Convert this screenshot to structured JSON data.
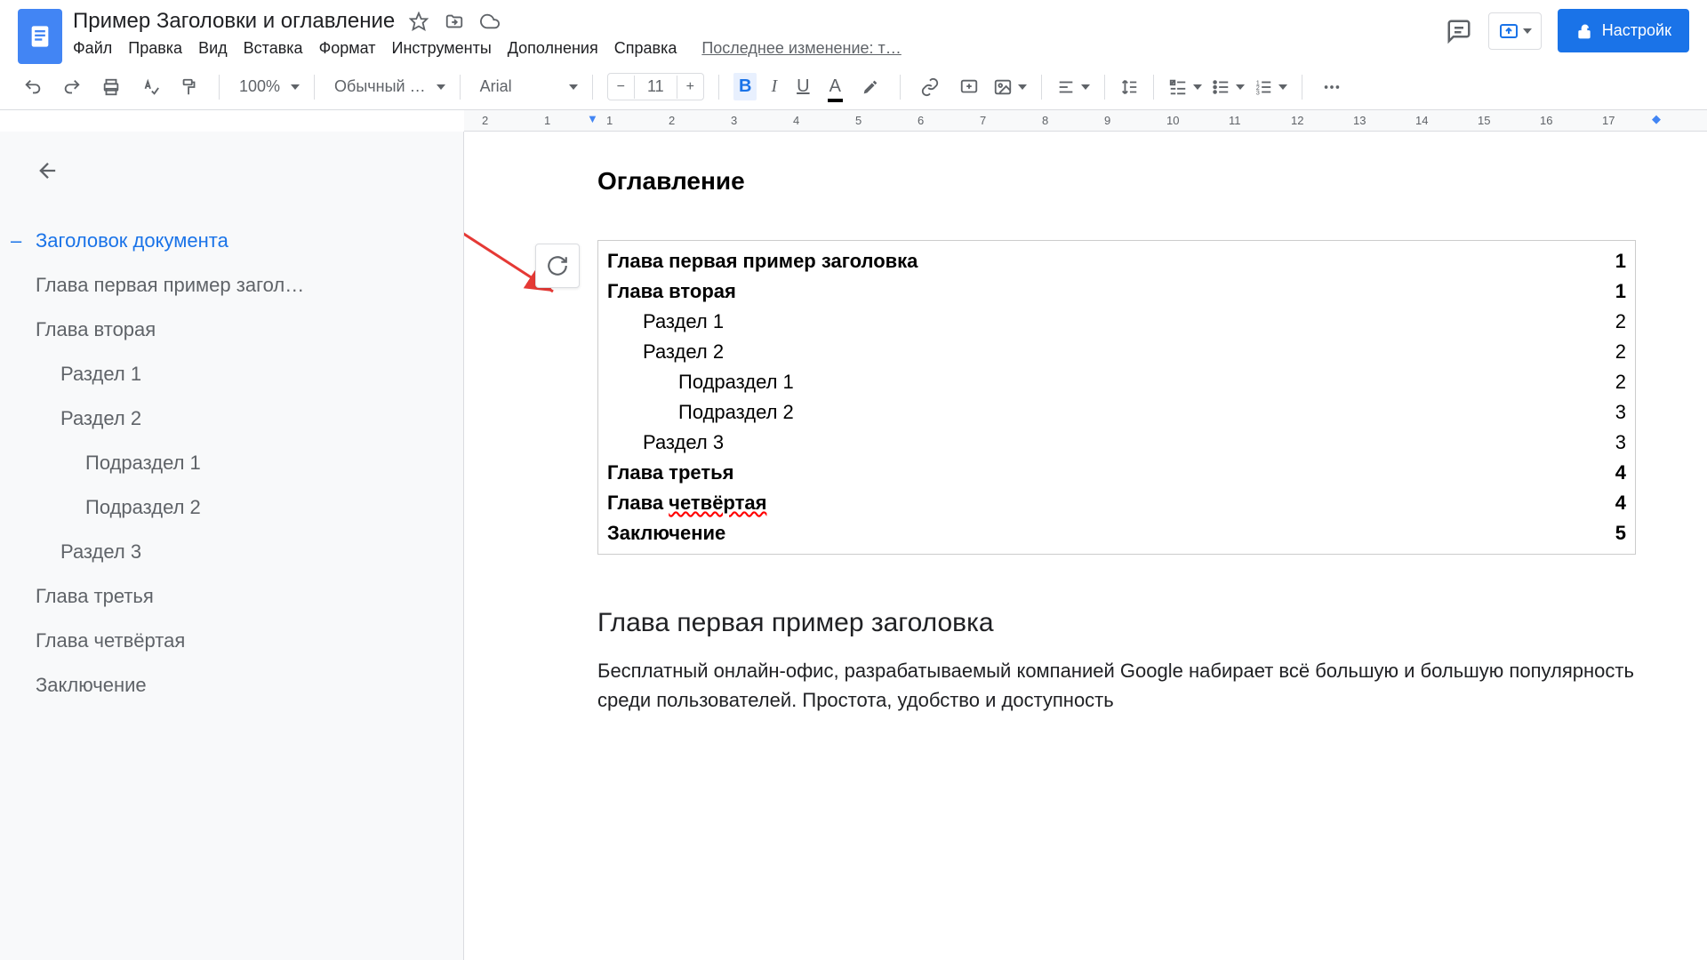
{
  "header": {
    "title": "Пример Заголовки и оглавление",
    "last_edit": "Последнее изменение: т…",
    "settings_label": "Настройк"
  },
  "menu": {
    "file": "Файл",
    "edit": "Правка",
    "view": "Вид",
    "insert": "Вставка",
    "format": "Формат",
    "tools": "Инструменты",
    "addons": "Дополнения",
    "help": "Справка"
  },
  "toolbar": {
    "zoom": "100%",
    "style": "Обычный …",
    "font": "Arial",
    "font_size": "11"
  },
  "ruler": {
    "marks": [
      "2",
      "1",
      "1",
      "2",
      "3",
      "4",
      "5",
      "6",
      "7",
      "8",
      "9",
      "10",
      "11",
      "12",
      "13",
      "14",
      "15",
      "16",
      "17"
    ]
  },
  "outline": {
    "items": [
      {
        "label": "Заголовок документа",
        "indent": 0,
        "active": true
      },
      {
        "label": "Глава первая пример загол…",
        "indent": 0
      },
      {
        "label": "Глава вторая",
        "indent": 0
      },
      {
        "label": "Раздел 1",
        "indent": 1
      },
      {
        "label": "Раздел 2",
        "indent": 1
      },
      {
        "label": "Подраздел 1",
        "indent": 2
      },
      {
        "label": "Подраздел 2",
        "indent": 2
      },
      {
        "label": "Раздел 3",
        "indent": 1
      },
      {
        "label": "Глава третья",
        "indent": 0
      },
      {
        "label": "Глава четвёртая",
        "indent": 0
      },
      {
        "label": "Заключение",
        "indent": 0
      }
    ]
  },
  "document": {
    "heading": "Оглавление",
    "toc": [
      {
        "title": "Глава первая пример заголовка",
        "page": "1",
        "bold": true,
        "indent": 0
      },
      {
        "title": "Глава вторая",
        "page": "1",
        "bold": true,
        "indent": 0
      },
      {
        "title": "Раздел 1",
        "page": "2",
        "bold": false,
        "indent": 1
      },
      {
        "title": "Раздел 2",
        "page": "2",
        "bold": false,
        "indent": 1
      },
      {
        "title": "Подраздел 1",
        "page": "2",
        "bold": false,
        "indent": 2
      },
      {
        "title": "Подраздел 2",
        "page": "3",
        "bold": false,
        "indent": 2
      },
      {
        "title": "Раздел 3",
        "page": "3",
        "bold": false,
        "indent": 1
      },
      {
        "title": "Глава третья",
        "page": "4",
        "bold": true,
        "indent": 0
      },
      {
        "title": "Глава четвёртая",
        "page": "4",
        "bold": true,
        "indent": 0,
        "spellerror": "четвёртая",
        "prefix": "Глава "
      },
      {
        "title": "Заключение",
        "page": "5",
        "bold": true,
        "indent": 0
      }
    ],
    "chapter_title": "Глава первая пример заголовка",
    "body_text": "Бесплатный онлайн-офис, разрабатываемый компанией Google набирает всё большую и большую популярность среди пользователей. Простота, удобство и доступность"
  }
}
